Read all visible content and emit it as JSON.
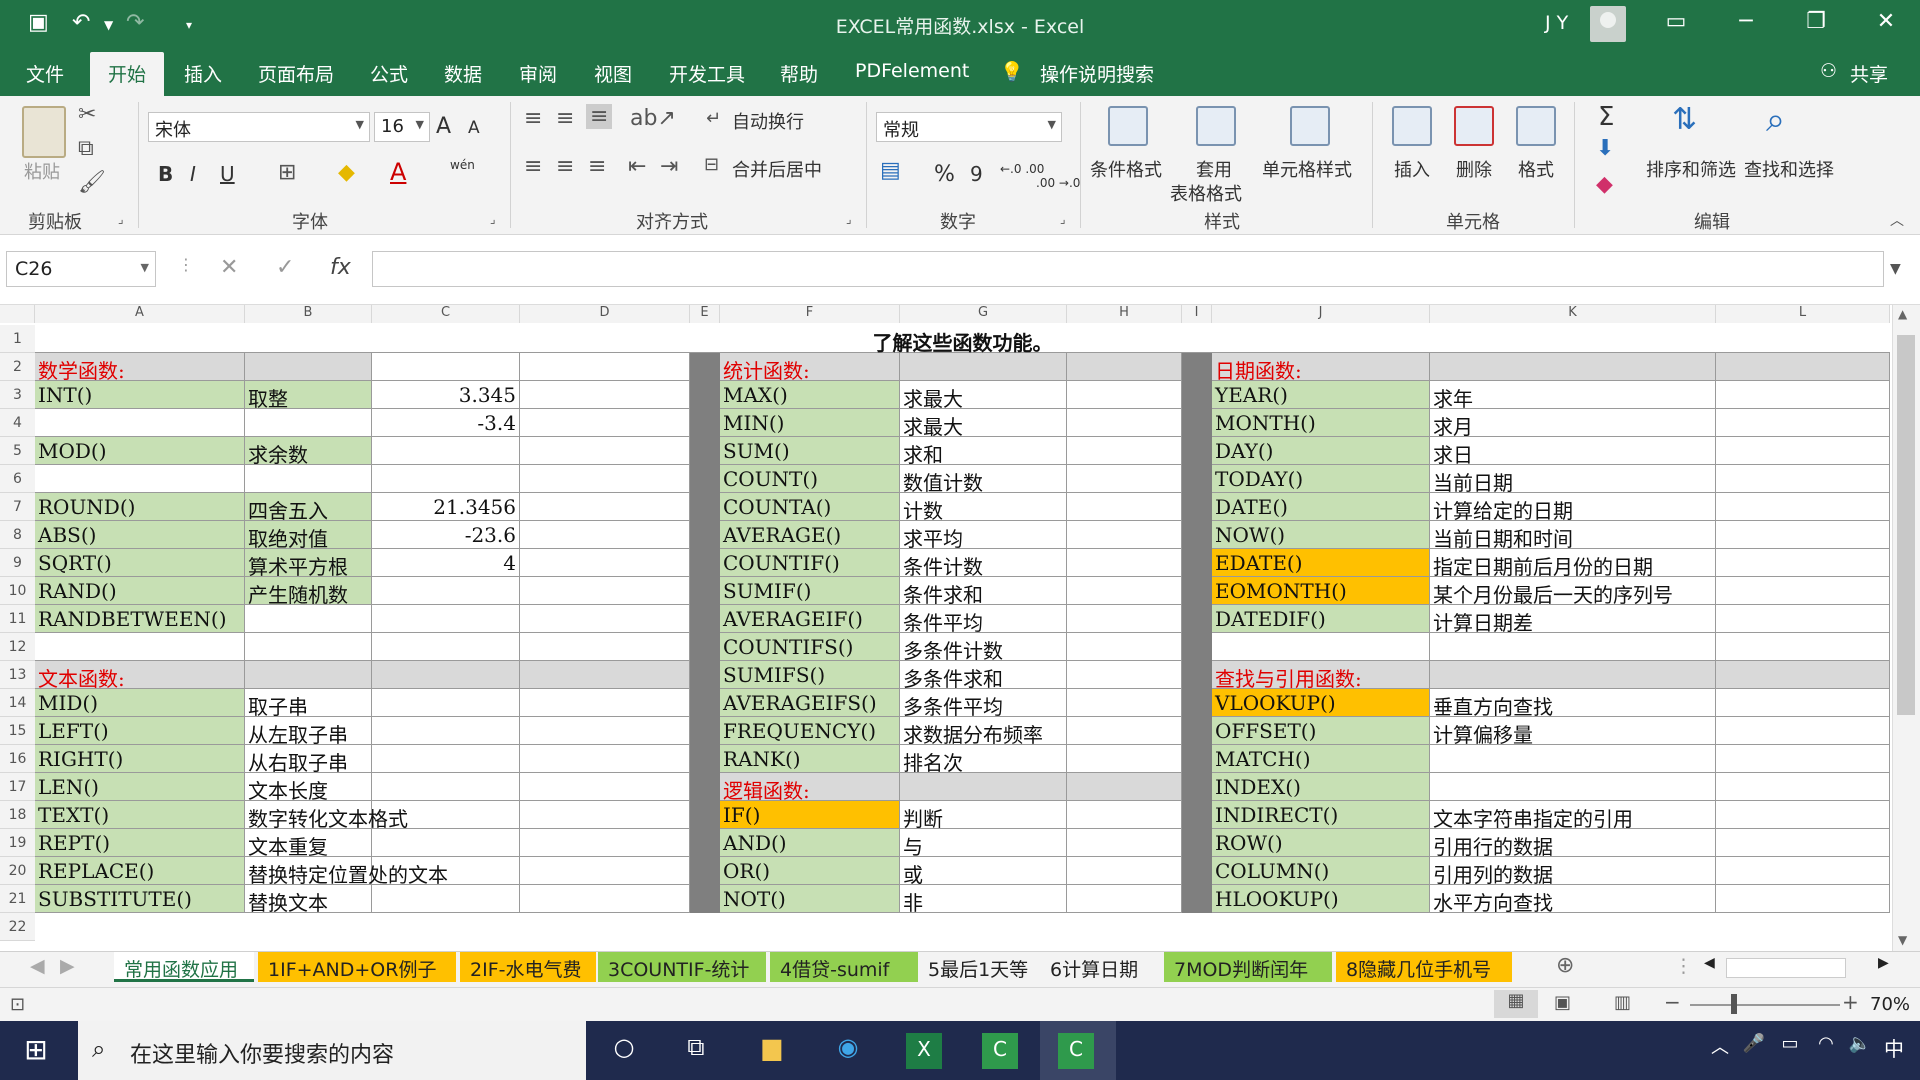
{
  "window": {
    "title": "EXCEL常用函数.xlsx  -  Excel",
    "user": "J Y",
    "minimize": "─",
    "restore": "❐",
    "maximize": "▭",
    "close": "✕"
  },
  "menu": {
    "file": "文件",
    "home": "开始",
    "insert": "插入",
    "layout": "页面布局",
    "formulas": "公式",
    "data": "数据",
    "review": "审阅",
    "view": "视图",
    "dev": "开发工具",
    "help": "帮助",
    "pdf": "PDFelement",
    "tellme": "操作说明搜索",
    "share": "共享"
  },
  "ribbon": {
    "clipboard": {
      "label": "剪贴板",
      "paste": "粘贴"
    },
    "font": {
      "label": "字体",
      "name": "宋体",
      "size": "16",
      "bold": "B",
      "italic": "I",
      "underline": "U",
      "grow": "A",
      "shrink": "A",
      "wen": "wén",
      "color_letter": "A"
    },
    "align": {
      "label": "对齐方式",
      "wrap": "自动换行",
      "merge": "合并后居中"
    },
    "number": {
      "label": "数字",
      "format": "常规",
      "percent": "%",
      "comma": "9",
      "inc": "←.0 .00",
      "dec": ".00 →.0"
    },
    "styles": {
      "label": "样式",
      "cond": "条件格式",
      "table1": "套用",
      "table2": "表格格式",
      "cell": "单元格样式"
    },
    "cells": {
      "label": "单元格",
      "insert": "插入",
      "delete": "删除",
      "format": "格式"
    },
    "edit": {
      "label": "编辑",
      "sort": "排序和筛选",
      "find": "查找和选择",
      "sigma": "Σ"
    }
  },
  "formula_bar": {
    "name_box": "C26",
    "fx": "fx",
    "cancel": "✕",
    "enter": "✓",
    "value": ""
  },
  "columns": [
    "A",
    "B",
    "C",
    "D",
    "E",
    "F",
    "G",
    "H",
    "I",
    "J",
    "K",
    "L"
  ],
  "rows": [
    "1",
    "2",
    "3",
    "4",
    "5",
    "6",
    "7",
    "8",
    "9",
    "10",
    "11",
    "12",
    "13",
    "14",
    "15",
    "16",
    "17",
    "18",
    "19",
    "20",
    "21",
    "22"
  ],
  "sheet": {
    "title": "了解这些函数功能。",
    "math": {
      "header": "数学函数:",
      "items": [
        [
          "INT()",
          "取整",
          "3.345"
        ],
        [
          "",
          "",
          "-3.4"
        ],
        [
          "MOD()",
          "求余数",
          ""
        ],
        [
          "",
          "",
          ""
        ],
        [
          "ROUND()",
          "四舍五入",
          "21.3456"
        ],
        [
          "ABS()",
          "取绝对值",
          "-23.6"
        ],
        [
          "SQRT()",
          "算术平方根",
          "4"
        ],
        [
          "RAND()",
          "产生随机数",
          ""
        ],
        [
          "RANDBETWEEN()",
          "",
          ""
        ]
      ]
    },
    "text": {
      "header": "文本函数:",
      "items": [
        [
          "MID()",
          "取子串"
        ],
        [
          "LEFT()",
          "从左取子串"
        ],
        [
          "RIGHT()",
          "从右取子串"
        ],
        [
          "LEN()",
          "文本长度"
        ],
        [
          "TEXT()",
          "数字转化文本格式"
        ],
        [
          "REPT()",
          "文本重复"
        ],
        [
          "REPLACE()",
          "替换特定位置处的文本"
        ],
        [
          "SUBSTITUTE()",
          "替换文本"
        ]
      ]
    },
    "stats": {
      "header": "统计函数:",
      "items": [
        [
          "MAX()",
          "求最大"
        ],
        [
          "MIN()",
          "求最大"
        ],
        [
          "SUM()",
          "求和"
        ],
        [
          "COUNT()",
          "数值计数"
        ],
        [
          "COUNTA()",
          "计数"
        ],
        [
          "AVERAGE()",
          "求平均"
        ],
        [
          "COUNTIF()",
          "条件计数"
        ],
        [
          "SUMIF()",
          "条件求和"
        ],
        [
          "AVERAGEIF()",
          "条件平均"
        ],
        [
          "COUNTIFS()",
          "多条件计数"
        ],
        [
          "SUMIFS()",
          "多条件求和"
        ],
        [
          "AVERAGEIFS()",
          "多条件平均"
        ],
        [
          "FREQUENCY()",
          "求数据分布频率"
        ],
        [
          "RANK()",
          "排名次"
        ]
      ]
    },
    "logic": {
      "header": "逻辑函数:",
      "items": [
        [
          "IF()",
          "判断"
        ],
        [
          "AND()",
          "与"
        ],
        [
          "OR()",
          "或"
        ],
        [
          "NOT()",
          "非"
        ]
      ]
    },
    "date": {
      "header": "日期函数:",
      "items": [
        [
          "YEAR()",
          "求年"
        ],
        [
          "MONTH()",
          "求月"
        ],
        [
          "DAY()",
          "求日"
        ],
        [
          "TODAY()",
          "当前日期"
        ],
        [
          "DATE()",
          "计算给定的日期"
        ],
        [
          "NOW()",
          "当前日期和时间"
        ],
        [
          "EDATE()",
          "指定日期前后月份的日期"
        ],
        [
          "EOMONTH()",
          "某个月份最后一天的序列号"
        ],
        [
          "DATEDIF()",
          "计算日期差"
        ]
      ]
    },
    "lookup": {
      "header": "查找与引用函数:",
      "items": [
        [
          "VLOOKUP()",
          "垂直方向查找"
        ],
        [
          "OFFSET()",
          "计算偏移量"
        ],
        [
          "MATCH()",
          ""
        ],
        [
          "INDEX()",
          ""
        ],
        [
          "INDIRECT()",
          "文本字符串指定的引用"
        ],
        [
          "ROW()",
          "引用行的数据"
        ],
        [
          "COLUMN()",
          "引用列的数据"
        ],
        [
          "HLOOKUP()",
          "水平方向查找"
        ]
      ]
    }
  },
  "tabs": [
    "常用函数应用",
    "1IF+AND+OR例子",
    "2IF-水电气费",
    "3COUNTIF-统计",
    "4借贷-sumif",
    "5最后1天等",
    "6计算日期",
    "7MOD判断闰年",
    "8隐藏几位手机号"
  ],
  "status": {
    "zoom": "70%"
  },
  "taskbar": {
    "search_placeholder": "在这里输入你要搜索的内容",
    "ime": "中"
  },
  "colors": {
    "excel_green": "#217346",
    "cell_green": "#c7e0b4",
    "cell_orange": "#ffc000",
    "cell_gray": "#d9d9d9",
    "header_red": "#e00000"
  }
}
